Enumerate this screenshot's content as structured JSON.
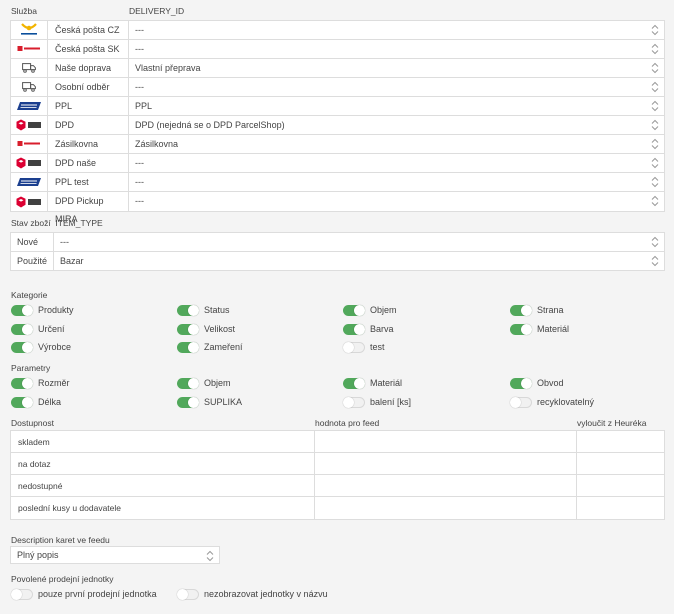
{
  "delivery": {
    "label_service": "Služba",
    "label_id": "DELIVERY_ID",
    "rows": [
      {
        "name": "Česká pošta CZ",
        "value": "---",
        "logo": "ceska-posta-logo"
      },
      {
        "name": "Česká pošta SK",
        "value": "---",
        "logo": "balikovna-logo"
      },
      {
        "name": "Naše doprava",
        "value": "Vlastní přeprava",
        "logo": "truck-icon"
      },
      {
        "name": "Osobní odběr",
        "value": "---",
        "logo": "truck-icon"
      },
      {
        "name": "PPL",
        "value": "PPL",
        "logo": "ppl-logo"
      },
      {
        "name": "DPD",
        "value": "DPD (nejedná se o DPD ParcelShop)",
        "logo": "dpd-logo"
      },
      {
        "name": "Zásilkovna",
        "value": "Zásilkovna",
        "logo": "balikovna-logo"
      },
      {
        "name": "DPD naše",
        "value": "---",
        "logo": "dpd-logo"
      },
      {
        "name": "PPL test",
        "value": "---",
        "logo": "ppl-logo"
      },
      {
        "name": "DPD Pickup MIRA",
        "value": "---",
        "logo": "dpd-logo"
      }
    ]
  },
  "item_type": {
    "label": "Stav zboží",
    "key": "ITEM_TYPE",
    "rows": [
      {
        "name": "Nové",
        "value": "---"
      },
      {
        "name": "Použité",
        "value": "Bazar"
      }
    ]
  },
  "kategorie": {
    "label": "Kategorie",
    "items": [
      {
        "label": "Produkty",
        "on": true
      },
      {
        "label": "Status",
        "on": true
      },
      {
        "label": "Objem",
        "on": true
      },
      {
        "label": "Strana",
        "on": true
      },
      {
        "label": "Určení",
        "on": true
      },
      {
        "label": "Velikost",
        "on": true
      },
      {
        "label": "Barva",
        "on": true
      },
      {
        "label": "Materiál",
        "on": true
      },
      {
        "label": "Výrobce",
        "on": true
      },
      {
        "label": "Zameření",
        "on": true
      },
      {
        "label": "test",
        "on": false
      }
    ]
  },
  "parametry": {
    "label": "Parametry",
    "items": [
      {
        "label": "Rozměr",
        "on": true
      },
      {
        "label": "Objem",
        "on": true
      },
      {
        "label": "Materiál",
        "on": true
      },
      {
        "label": "Obvod",
        "on": true
      },
      {
        "label": "Délka",
        "on": true
      },
      {
        "label": "SUPLIKA",
        "on": true
      },
      {
        "label": "balení [ks]",
        "on": false
      },
      {
        "label": "recyklovatelný",
        "on": false
      }
    ]
  },
  "dostupnost": {
    "label": "Dostupnost",
    "col_feed": "hodnota pro feed",
    "col_exclude": "vyloučit z Heuréka",
    "rows": [
      "skladem",
      "na dotaz",
      "nedostupné",
      "poslední kusy u dodavatele"
    ]
  },
  "description": {
    "label": "Description karet ve feedu",
    "value": "Plný popis"
  },
  "units": {
    "label": "Povolené prodejní jednotky",
    "items": [
      {
        "label": "pouze první prodejní jednotka",
        "on": false
      },
      {
        "label": "nezobrazovat jednotky v názvu",
        "on": false
      }
    ]
  },
  "colors": {
    "toggle_on": "#51a85b",
    "dpd": "#dc0032",
    "ppl": "#1b3f8f"
  }
}
